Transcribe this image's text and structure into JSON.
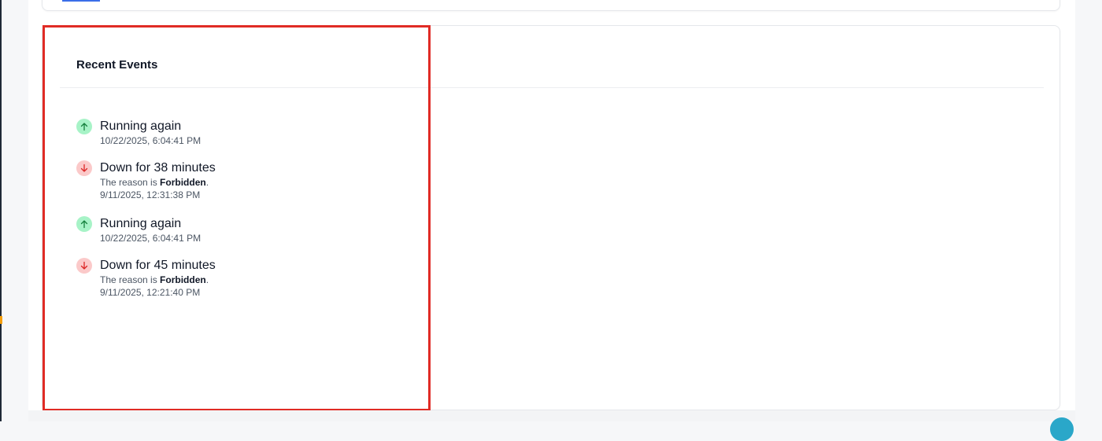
{
  "events_panel": {
    "title": "Recent Events",
    "events": [
      {
        "status": "up",
        "icon": "arrow-up-icon",
        "title": "Running again",
        "timestamp": "10/22/2025, 6:04:41 PM"
      },
      {
        "status": "down",
        "icon": "arrow-down-icon",
        "title": "Down for 38 minutes",
        "reason_prefix": "The reason is",
        "reason": "Forbidden",
        "reason_suffix": ".",
        "timestamp": "9/11/2025, 12:31:38 PM"
      },
      {
        "status": "up",
        "icon": "arrow-up-icon",
        "title": "Running again",
        "timestamp": "10/22/2025, 6:04:41 PM"
      },
      {
        "status": "down",
        "icon": "arrow-down-icon",
        "title": "Down for 45 minutes",
        "reason_prefix": "The reason is",
        "reason": "Forbidden",
        "reason_suffix": ".",
        "timestamp": "9/11/2025, 12:21:40 PM"
      }
    ]
  },
  "colors": {
    "up_badge": "#a7f3c7",
    "up_arrow": "#15803d",
    "down_badge": "#fbc9c9",
    "down_arrow": "#dc2626",
    "highlight": "#e02b25",
    "tab_indicator": "#3b6ee8"
  }
}
